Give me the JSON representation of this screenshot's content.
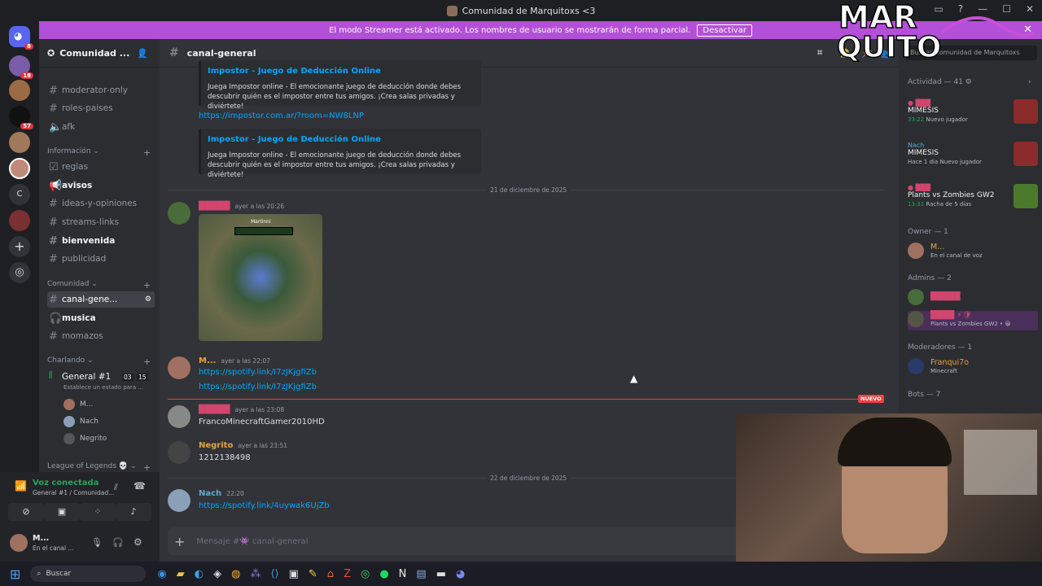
{
  "window": {
    "title": "Comunidad de Marquitoxs <3"
  },
  "banner": {
    "text": "El modo Streamer está activado. Los nombres de usuario se mostrarán de forma parcial.",
    "button": "Desactivar"
  },
  "logo": {
    "line1": "MAR",
    "line2": "QUITO"
  },
  "guild_badges": [
    "8",
    "18",
    "57"
  ],
  "server": {
    "name": "Comunidad ..."
  },
  "channels": {
    "top": [
      {
        "label": "moderator-only"
      },
      {
        "label": "roles-paises"
      },
      {
        "label": "afk"
      }
    ],
    "cat_info": "Información",
    "info": [
      {
        "label": "reglas"
      },
      {
        "label": "avisos"
      },
      {
        "label": "ideas-y-opiniones"
      },
      {
        "label": "streams-links"
      },
      {
        "label": "bienvenida"
      },
      {
        "label": "publicidad"
      }
    ],
    "cat_comunidad": "Comunidad",
    "comunidad": [
      {
        "label": "canal-gene..."
      },
      {
        "label": "musica"
      },
      {
        "label": "momazos"
      }
    ],
    "cat_charlando": "Charlando",
    "voice": {
      "name": "General #1",
      "count1": "03",
      "count2": "15",
      "status": "Establece un estado para ...",
      "users": [
        "M...",
        "Nach",
        "Negrito"
      ]
    },
    "cat_lol": "League of Legends"
  },
  "voice_panel": {
    "status": "Voz conectada",
    "location": "General #1 / Comunidad...",
    "user": "M...",
    "user_status": "En el canal ..."
  },
  "chat": {
    "channel": "canal-general",
    "embed_title": "Impostor - Juego de Deducción Online",
    "embed_desc": "Juega Impostor online - El emocionante juego de deducción donde debes descubrir quién es el impostor entre tus amigos. ¡Crea salas privadas y diviértete!",
    "impostor_link": "https://impostor.com.ar/?room=NW8LNP",
    "date1": "21 de diciembre de 2025",
    "date2": "22 de diciembre de 2025",
    "new_label": "NUEVO",
    "image_caption": "Martinni",
    "messages": [
      {
        "time": "ayer a las 20:26"
      },
      {
        "name": "M...",
        "time": "ayer a las 22:07",
        "links": [
          "https://spotify.link/I7zJKjgfiZb",
          "https://spotify.link/I7zJKjgfiZb"
        ]
      },
      {
        "time": "ayer a las 23:08",
        "text": "FrancoMinecraftGamer2010HD"
      },
      {
        "name": "Negrito",
        "time": "ayer a las 23:51",
        "text": "1212138498"
      },
      {
        "name": "Nach",
        "time": "22:20",
        "link": "https://spotify.link/4uywak6UjZb"
      }
    ],
    "composer_placeholder": "Mensaje #👾 canal-general"
  },
  "members": {
    "search_placeholder": "Buscar Comunidad de Marquitoxs",
    "activity_header": "Actividad — 41",
    "activities": [
      {
        "title": "MIMESIS",
        "sub1": "33:22",
        "sub2": "Nuevo jugador"
      },
      {
        "name": "Nach",
        "title": "MIMESIS",
        "sub1": "Hace 1 día",
        "sub2": "Nuevo jugador"
      },
      {
        "title": "Plants vs Zombies GW2",
        "sub1": "13:31",
        "sub2": "Racha de 5 días"
      }
    ],
    "owner_header": "Owner — 1",
    "owner": {
      "name": "M...",
      "status": "En el canal de voz"
    },
    "admins_header": "Admins — 2",
    "admin2_status": "Plants vs Zombies GW2 • 😀",
    "mods_header": "Moderadores — 1",
    "mod": {
      "name": "Franqui7o",
      "status": "Minecraft"
    },
    "bots_header": "Bots — 7"
  },
  "taskbar": {
    "search": "Buscar"
  }
}
